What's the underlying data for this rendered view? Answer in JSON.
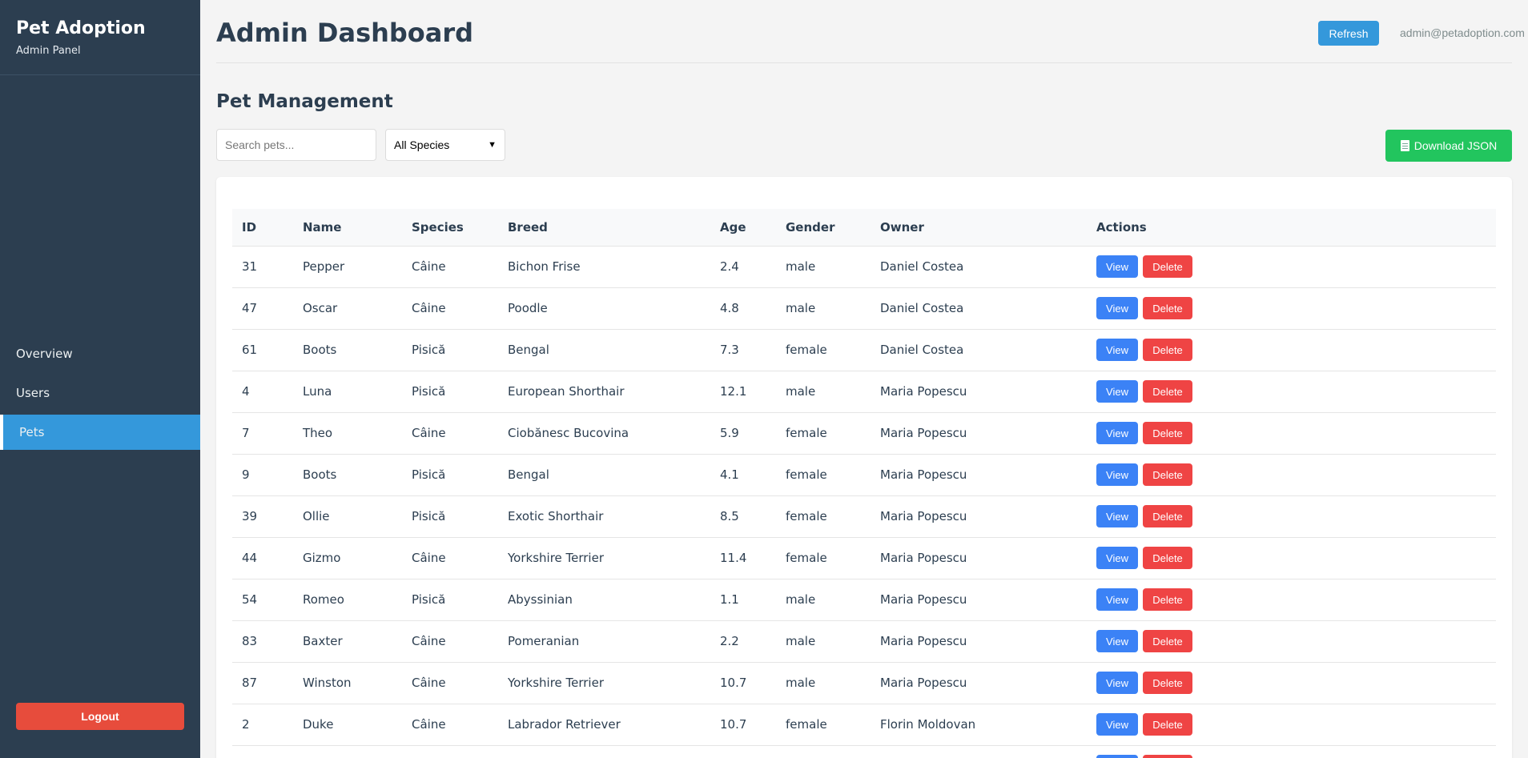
{
  "sidebar": {
    "brand_title": "Pet Adoption",
    "brand_subtitle": "Admin Panel",
    "items": [
      {
        "label": "Overview",
        "active": false
      },
      {
        "label": "Users",
        "active": false
      },
      {
        "label": "Pets",
        "active": true
      }
    ],
    "logout_label": "Logout"
  },
  "header": {
    "title": "Admin Dashboard",
    "refresh_label": "Refresh",
    "user_email": "admin@petadoption.com"
  },
  "pets": {
    "section_title": "Pet Management",
    "search_placeholder": "Search pets...",
    "species_filter": "All Species",
    "download_label": "Download JSON",
    "columns": [
      "ID",
      "Name",
      "Species",
      "Breed",
      "Age",
      "Gender",
      "Owner",
      "Actions"
    ],
    "view_label": "View",
    "delete_label": "Delete",
    "rows": [
      {
        "id": "31",
        "name": "Pepper",
        "species": "Câine",
        "breed": "Bichon Frise",
        "age": "2.4",
        "gender": "male",
        "owner": "Daniel Costea"
      },
      {
        "id": "47",
        "name": "Oscar",
        "species": "Câine",
        "breed": "Poodle",
        "age": "4.8",
        "gender": "male",
        "owner": "Daniel Costea"
      },
      {
        "id": "61",
        "name": "Boots",
        "species": "Pisică",
        "breed": "Bengal",
        "age": "7.3",
        "gender": "female",
        "owner": "Daniel Costea"
      },
      {
        "id": "4",
        "name": "Luna",
        "species": "Pisică",
        "breed": "European Shorthair",
        "age": "12.1",
        "gender": "male",
        "owner": "Maria Popescu"
      },
      {
        "id": "7",
        "name": "Theo",
        "species": "Câine",
        "breed": "Ciobănesc Bucovina",
        "age": "5.9",
        "gender": "female",
        "owner": "Maria Popescu"
      },
      {
        "id": "9",
        "name": "Boots",
        "species": "Pisică",
        "breed": "Bengal",
        "age": "4.1",
        "gender": "female",
        "owner": "Maria Popescu"
      },
      {
        "id": "39",
        "name": "Ollie",
        "species": "Pisică",
        "breed": "Exotic Shorthair",
        "age": "8.5",
        "gender": "female",
        "owner": "Maria Popescu"
      },
      {
        "id": "44",
        "name": "Gizmo",
        "species": "Câine",
        "breed": "Yorkshire Terrier",
        "age": "11.4",
        "gender": "female",
        "owner": "Maria Popescu"
      },
      {
        "id": "54",
        "name": "Romeo",
        "species": "Pisică",
        "breed": "Abyssinian",
        "age": "1.1",
        "gender": "male",
        "owner": "Maria Popescu"
      },
      {
        "id": "83",
        "name": "Baxter",
        "species": "Câine",
        "breed": "Pomeranian",
        "age": "2.2",
        "gender": "male",
        "owner": "Maria Popescu"
      },
      {
        "id": "87",
        "name": "Winston",
        "species": "Câine",
        "breed": "Yorkshire Terrier",
        "age": "10.7",
        "gender": "male",
        "owner": "Maria Popescu"
      },
      {
        "id": "2",
        "name": "Duke",
        "species": "Câine",
        "breed": "Labrador Retriever",
        "age": "10.7",
        "gender": "female",
        "owner": "Florin Moldovan"
      }
    ]
  },
  "colors": {
    "sidebar_bg": "#2c3e50",
    "active_nav": "#3498db",
    "view_button": "#3b82f6",
    "delete_button": "#ef4444",
    "download_button": "#22c55e",
    "logout_button": "#e74c3c"
  }
}
